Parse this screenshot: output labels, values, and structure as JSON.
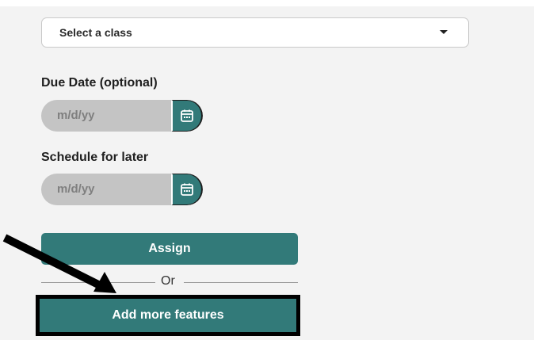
{
  "class_select": {
    "selected": "Select a class"
  },
  "due_date": {
    "label": "Due Date (optional)",
    "placeholder": "m/d/yy"
  },
  "schedule": {
    "label": "Schedule for later",
    "placeholder": "m/d/yy"
  },
  "actions": {
    "assign_label": "Assign",
    "or_label": "Or",
    "add_features_label": "Add more features"
  },
  "colors": {
    "accent": "#327a79",
    "field": "#c4c4c4",
    "panel": "#f3f3f3"
  },
  "icons": {
    "date_picker": "calendar-icon",
    "dropdown": "chevron-down-icon",
    "pointer": "arrow-icon"
  }
}
